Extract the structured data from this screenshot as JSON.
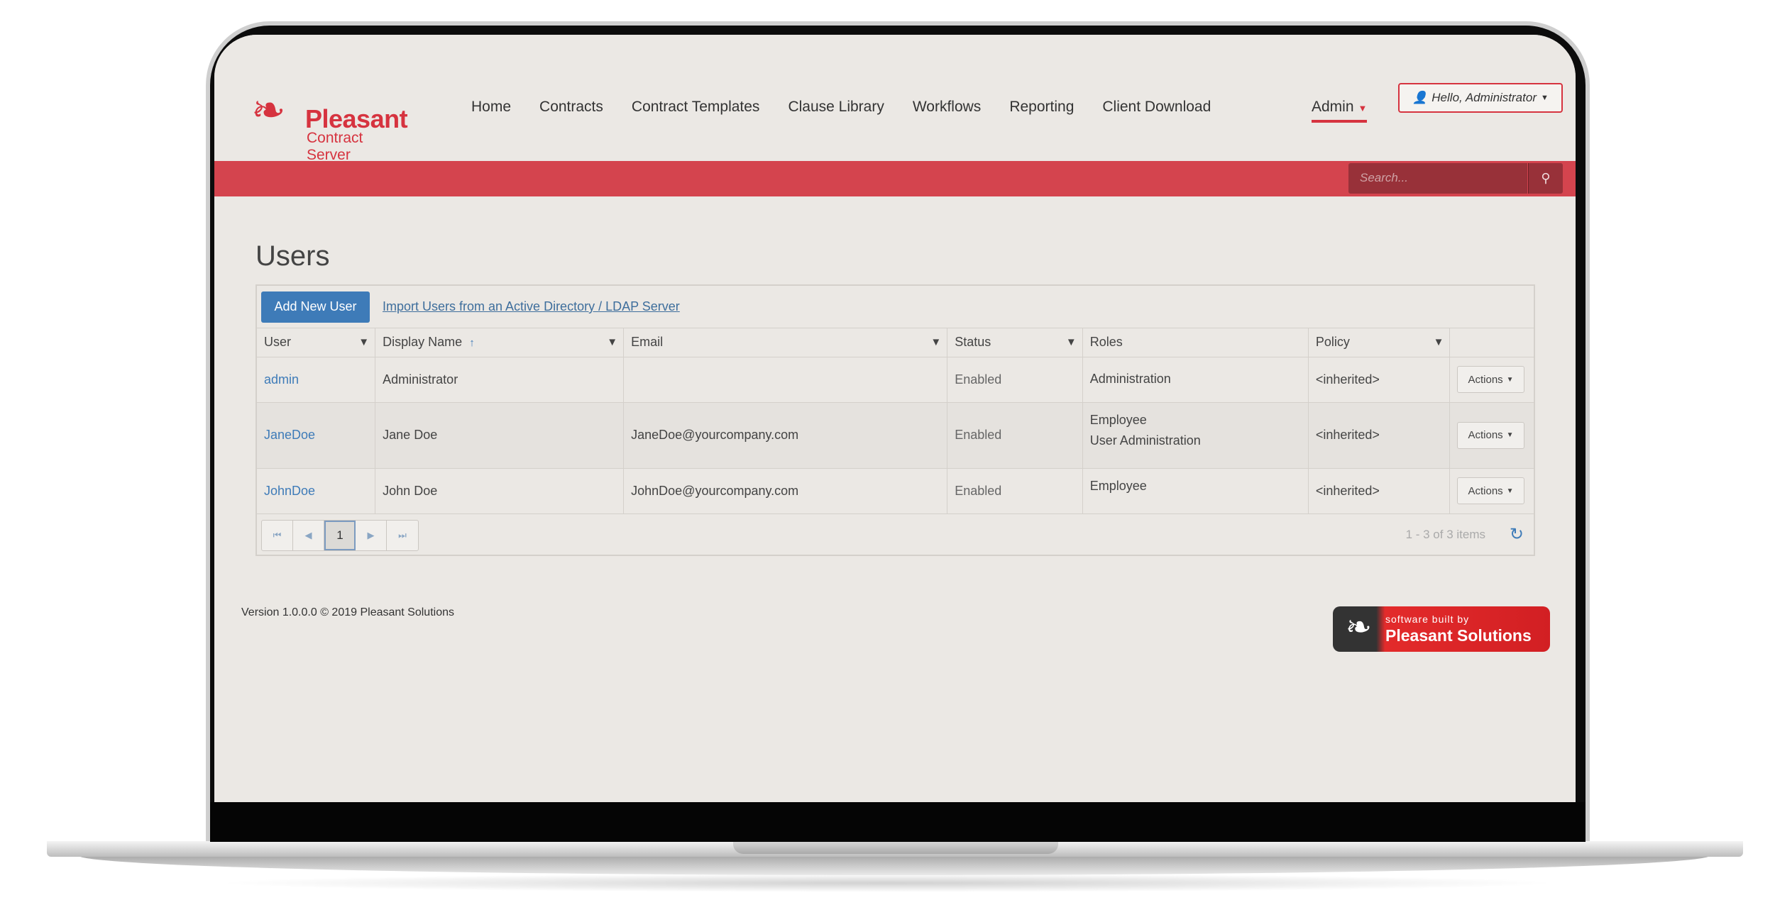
{
  "brand": {
    "name": "Pleasant",
    "subtitle": "Contract Server",
    "logo_icon": "hummingbird-icon",
    "accent_color": "#d6333f"
  },
  "nav": {
    "items": [
      {
        "label": "Home"
      },
      {
        "label": "Contracts"
      },
      {
        "label": "Contract Templates"
      },
      {
        "label": "Clause Library"
      },
      {
        "label": "Workflows"
      },
      {
        "label": "Reporting"
      },
      {
        "label": "Client Download"
      }
    ],
    "admin_label": "Admin",
    "user_label": "Hello, Administrator"
  },
  "search": {
    "placeholder": "Search..."
  },
  "page": {
    "title": "Users"
  },
  "toolbar": {
    "add_label": "Add New User",
    "import_label": "Import Users from an Active Directory / LDAP Server"
  },
  "table": {
    "columns": [
      "User",
      "Display Name",
      "Email",
      "Status",
      "Roles",
      "Policy"
    ],
    "rows": [
      {
        "user": "admin",
        "display_name": "Administrator",
        "email": "",
        "status": "Enabled",
        "roles": [
          "Administration"
        ],
        "policy": "<inherited>",
        "actions": "Actions"
      },
      {
        "user": "JaneDoe",
        "display_name": "Jane Doe",
        "email": "JaneDoe@yourcompany.com",
        "status": "Enabled",
        "roles": [
          "Employee",
          "User Administration"
        ],
        "policy": "<inherited>",
        "actions": "Actions"
      },
      {
        "user": "JohnDoe",
        "display_name": "John Doe",
        "email": "JohnDoe@yourcompany.com",
        "status": "Enabled",
        "roles": [
          "Employee"
        ],
        "policy": "<inherited>",
        "actions": "Actions"
      }
    ]
  },
  "pager": {
    "current_page": "1",
    "info": "1 - 3 of 3 items"
  },
  "footer": {
    "version": "Version 1.0.0.0 © 2019 Pleasant Solutions",
    "badge_small": "software built by",
    "badge_big": "Pleasant Solutions"
  }
}
